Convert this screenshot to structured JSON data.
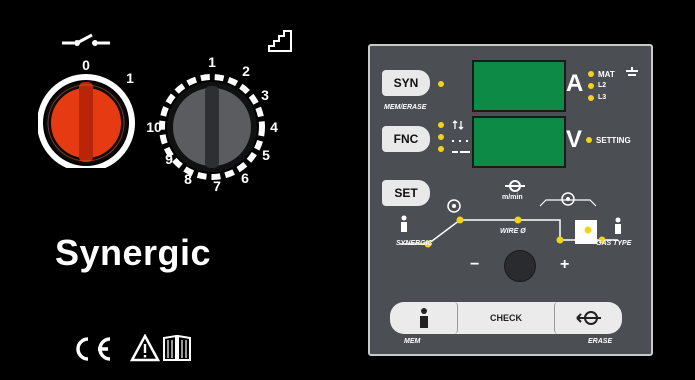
{
  "left_panel": {
    "power_switch": {
      "label_0": "0",
      "label_1": "1"
    },
    "voltage_selector": {
      "ticks": [
        "1",
        "2",
        "3",
        "4",
        "5",
        "6",
        "7",
        "8",
        "9",
        "10"
      ]
    },
    "brand": "Synergic"
  },
  "control_panel": {
    "syn_button": "SYN",
    "mem_erase_label": "MEM/ERASE",
    "fnc_button": "FNC",
    "set_button": "SET",
    "display_a_unit": "A",
    "display_v_unit": "V",
    "mat_label": "MAT",
    "l2_label": "L2",
    "l3_label": "L3",
    "setting_label": "SETTING",
    "m_min_label": "m/min",
    "wire_label": "WIRE Ø",
    "synergic_label": "SYNERGIC",
    "gas_type_label": "GAS TYPE",
    "minus_label": "−",
    "plus_label": "+",
    "check_label": "CHECK",
    "mem_label": "MEM",
    "erase_label": "ERASE"
  },
  "colors": {
    "led": "#f2d21b",
    "display": "#0d8a45",
    "power_knob": "#e53a12",
    "panel": "#4b4e53"
  }
}
